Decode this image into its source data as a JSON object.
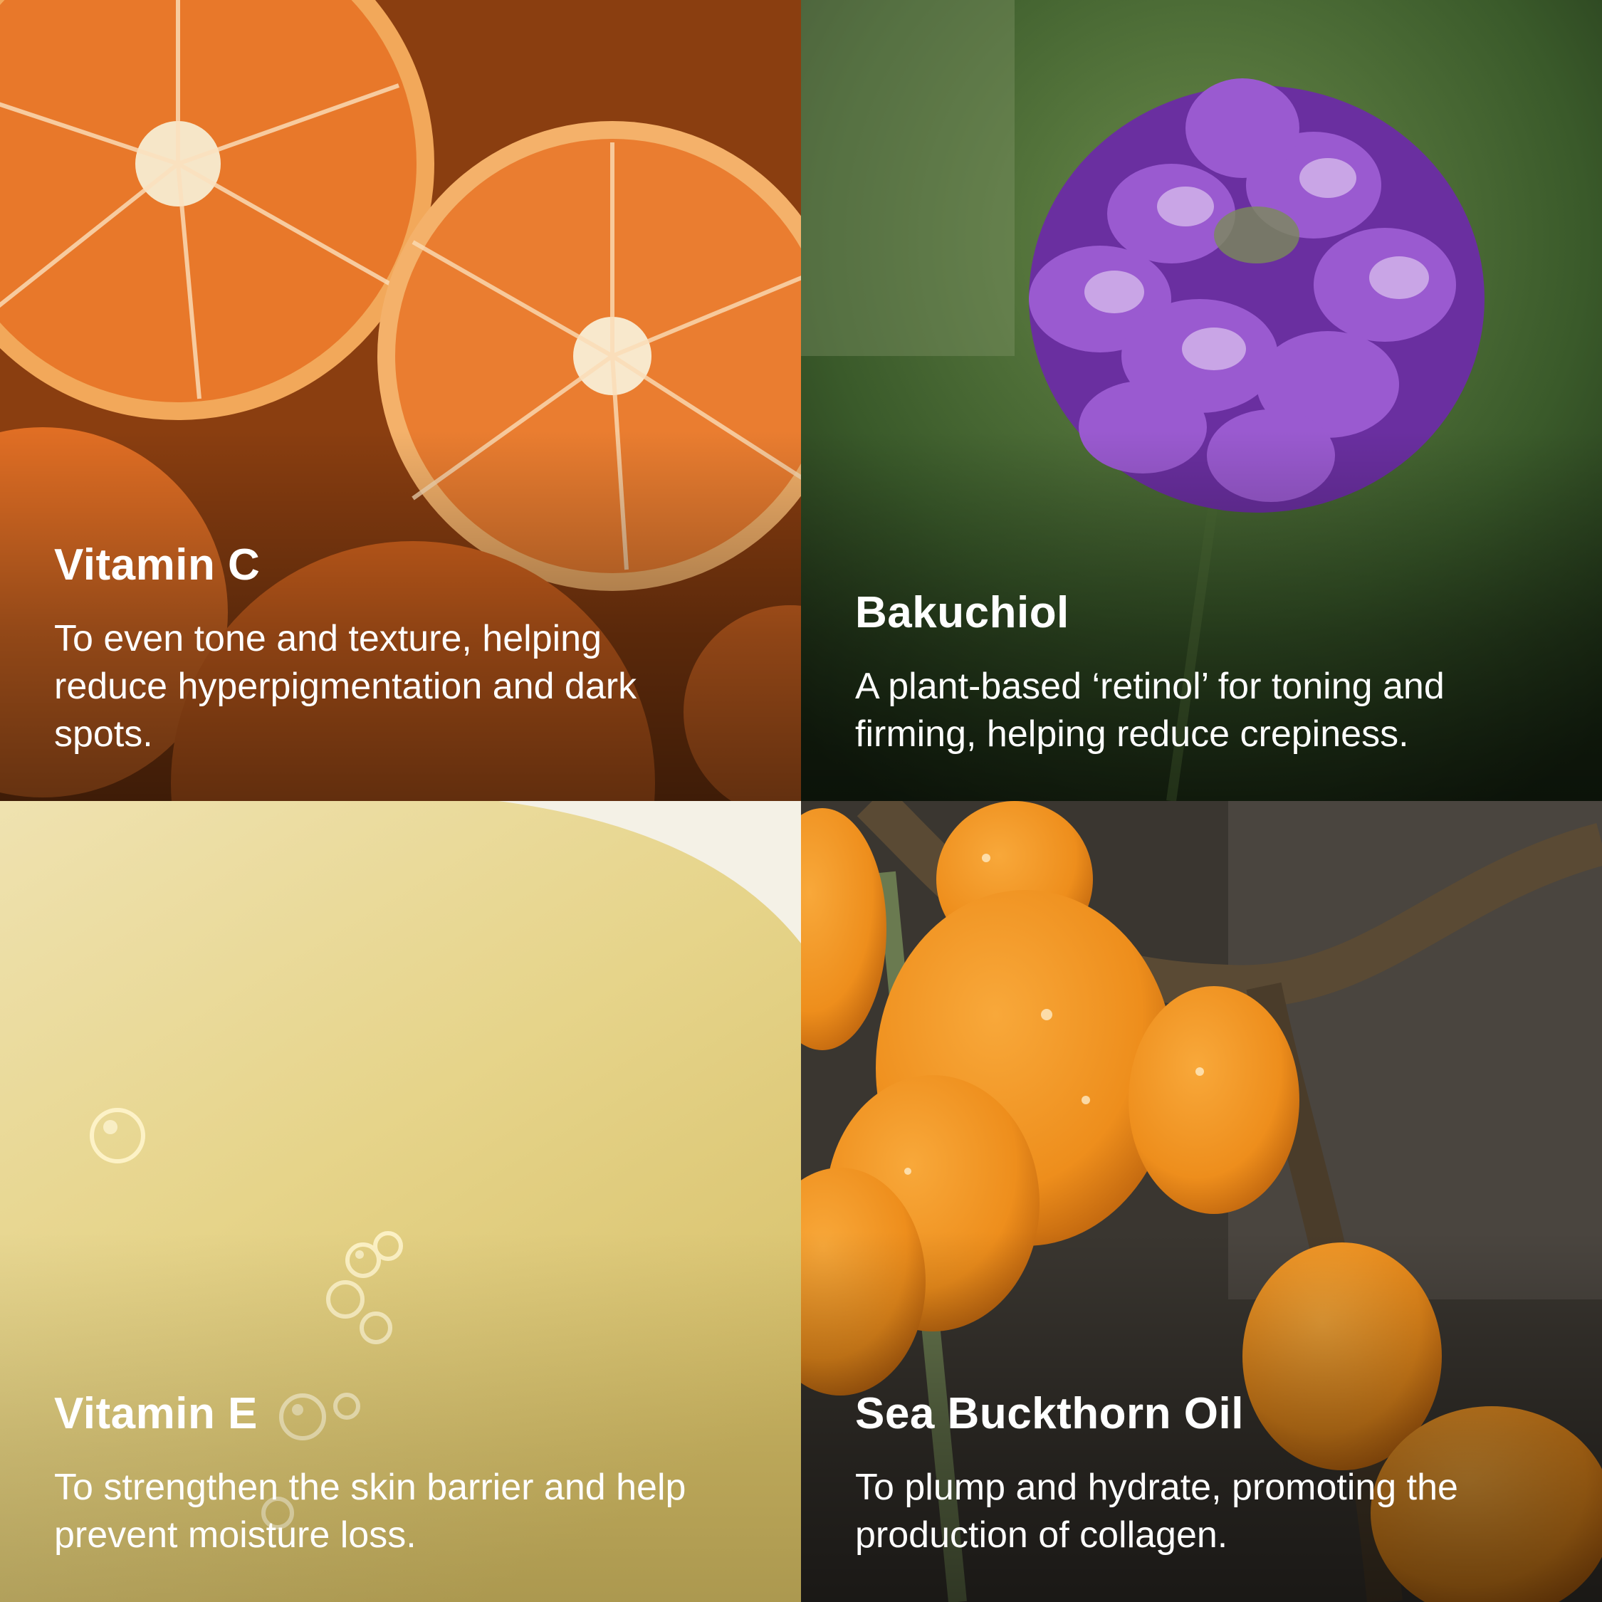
{
  "tiles": [
    {
      "title": "Vitamin C",
      "description": "To even tone and texture, helping reduce hyperpigmentation and dark spots.",
      "image": "halved-oranges-photo"
    },
    {
      "title": "Bakuchiol",
      "description": "A plant-based ‘retinol’ for toning and firming, helping reduce crepiness.",
      "image": "purple-bakuchiol-flower-photo"
    },
    {
      "title": "Vitamin E",
      "description": "To strengthen the skin barrier and help prevent moisture loss.",
      "image": "yellow-oil-bubbles-photo"
    },
    {
      "title": "Sea Buckthorn Oil",
      "description": "To plump and hydrate, promoting the production of collagen.",
      "image": "sea-buckthorn-berries-photo"
    }
  ],
  "colors": {
    "caption_text": "#ffffff",
    "orange": "#e8782a",
    "flower_purple": "#8a3fc0",
    "foliage_green": "#3a5a2a",
    "oil_yellow": "#e6d48a",
    "berry_orange": "#ee8e1c"
  }
}
